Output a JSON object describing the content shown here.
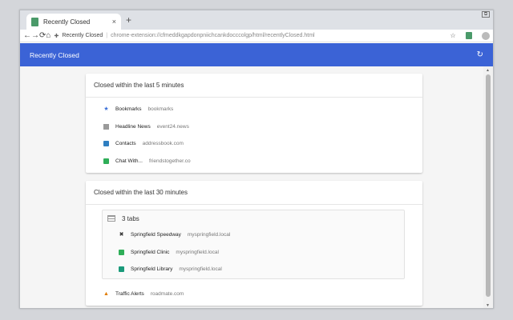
{
  "browser": {
    "tab_title": "Recently Closed",
    "tab_close": "×",
    "new_tab": "+",
    "window_button": "⧉",
    "nav": {
      "back": "←",
      "forward": "→",
      "reload": "⟳",
      "home": "⌂"
    },
    "omnibox": {
      "site_label": "Recently Closed",
      "separator": "|",
      "url": "chrome-extension://cfmeddkgapdonpniichcankdocccolgp/html/recentlyClosed.html"
    },
    "bookmark_star": "☆",
    "menu": "⋮"
  },
  "app": {
    "title": "Recently Closed",
    "refresh_glyph": "↻"
  },
  "sections": [
    {
      "heading": "Closed within the last 5 minutes",
      "items": [
        {
          "name": "Bookmarks",
          "domain": "bookmarks",
          "icon": "star-icon"
        },
        {
          "name": "Headline News",
          "domain": "event24.news",
          "icon": "news-icon"
        },
        {
          "name": "Contacts",
          "domain": "addressbook.com",
          "icon": "contacts-icon"
        },
        {
          "name": "Chat With...",
          "domain": "friendstogether.co",
          "icon": "chat-icon"
        }
      ]
    },
    {
      "heading": "Closed within the last 30 minutes",
      "group": {
        "label": "3 tabs",
        "items": [
          {
            "name": "Springfield Speedway",
            "domain": "myspringfield.local",
            "icon": "speedway-icon"
          },
          {
            "name": "Springfield Clinic",
            "domain": "myspringfield.local",
            "icon": "clinic-icon"
          },
          {
            "name": "Springfield Library",
            "domain": "myspringfield.local",
            "icon": "library-icon"
          }
        ]
      },
      "items": [
        {
          "name": "Traffic Alerts",
          "domain": "roadmate.com",
          "icon": "traffic-cone-icon"
        }
      ]
    }
  ]
}
